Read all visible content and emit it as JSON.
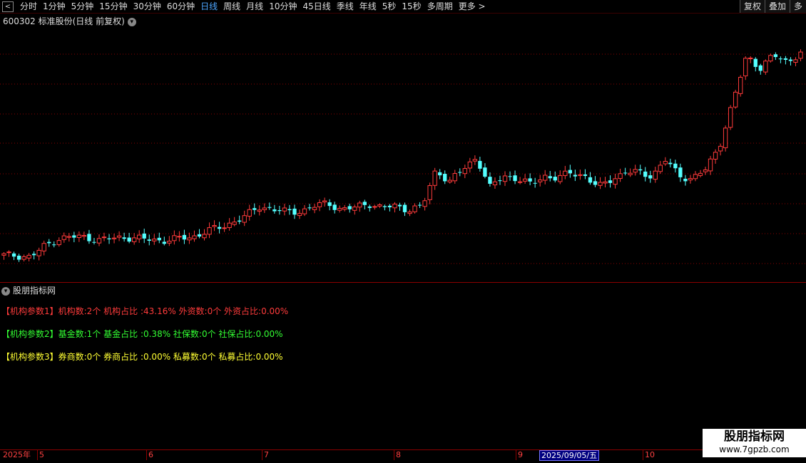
{
  "toolbar": {
    "back_label": "<",
    "periods": [
      "分时",
      "1分钟",
      "5分钟",
      "15分钟",
      "30分钟",
      "60分钟",
      "日线",
      "周线",
      "月线",
      "10分钟",
      "45日线",
      "季线",
      "年线",
      "5秒",
      "15秒",
      "多周期",
      "更多 >"
    ],
    "active_period": "日线",
    "right_buttons": [
      "复权",
      "叠加",
      "多"
    ]
  },
  "stock": {
    "title": "600302 标准股份(日线 前复权)"
  },
  "indicator": {
    "title": "股朋指标网",
    "lines": [
      "【机构参数1】机构数:2个 机构占比 :43.16% 外资数:0个 外资占比:0.00%",
      "【机构参数2】基金数:1个 基金占比 :0.38% 社保数:0个 社保占比:0.00%",
      "【机构参数3】券商数:0个 券商占比 :0.00% 私募数:0个 私募占比:0.00%"
    ]
  },
  "axis": {
    "year_label": "2025年",
    "months": [
      "5",
      "6",
      "7",
      "8",
      "9",
      "10"
    ],
    "cursor_date": "2025/09/05/五"
  },
  "watermark": {
    "line1": "股朋指标网",
    "line2": "www.7gpzb.com"
  },
  "colors": {
    "up": "#ff3b3b",
    "down": "#54ffff",
    "grid": "#8b0000",
    "active": "#4da6ff"
  },
  "chart_data": {
    "type": "candlestick",
    "close_path": [
      5.0,
      5.0,
      4.95,
      5.3,
      5.55,
      5.6,
      5.6,
      5.5,
      5.55,
      5.6,
      5.55,
      5.5,
      5.5,
      5.55,
      5.6,
      5.8,
      5.9,
      6.1,
      6.3,
      6.6,
      6.5,
      6.4,
      6.45,
      6.6,
      6.7,
      6.5,
      6.55,
      6.7,
      6.55,
      6.6,
      6.5,
      6.6,
      7.8,
      7.4,
      7.8,
      8.2,
      7.2,
      7.6,
      7.5,
      7.3,
      7.6,
      7.5,
      7.7,
      7.6,
      7.2,
      7.5,
      7.7,
      7.7,
      7.6,
      8.1,
      7.6,
      7.5,
      7.8,
      8.6,
      10.0,
      11.5,
      11.1,
      11.5,
      11.3,
      11.6
    ]
  }
}
